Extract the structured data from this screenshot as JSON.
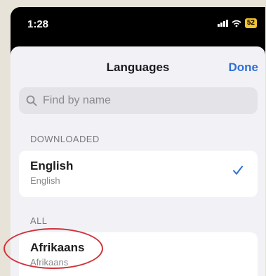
{
  "status_bar": {
    "time": "1:28",
    "battery": "52",
    "icons": [
      "signal-icon",
      "wifi-icon",
      "battery-icon"
    ]
  },
  "nav": {
    "title": "Languages",
    "done_label": "Done"
  },
  "search": {
    "placeholder": "Find by name",
    "value": ""
  },
  "sections": {
    "downloaded": {
      "header": "DOWNLOADED",
      "items": [
        {
          "name": "English",
          "native": "English",
          "selected": true
        }
      ]
    },
    "all": {
      "header": "ALL",
      "items": [
        {
          "name": "Afrikaans",
          "native": "Afrikaans",
          "selected": false
        }
      ]
    }
  },
  "colors": {
    "accent": "#2f6fd6",
    "annotation": "#d0313a",
    "battery": "#f2c230"
  }
}
